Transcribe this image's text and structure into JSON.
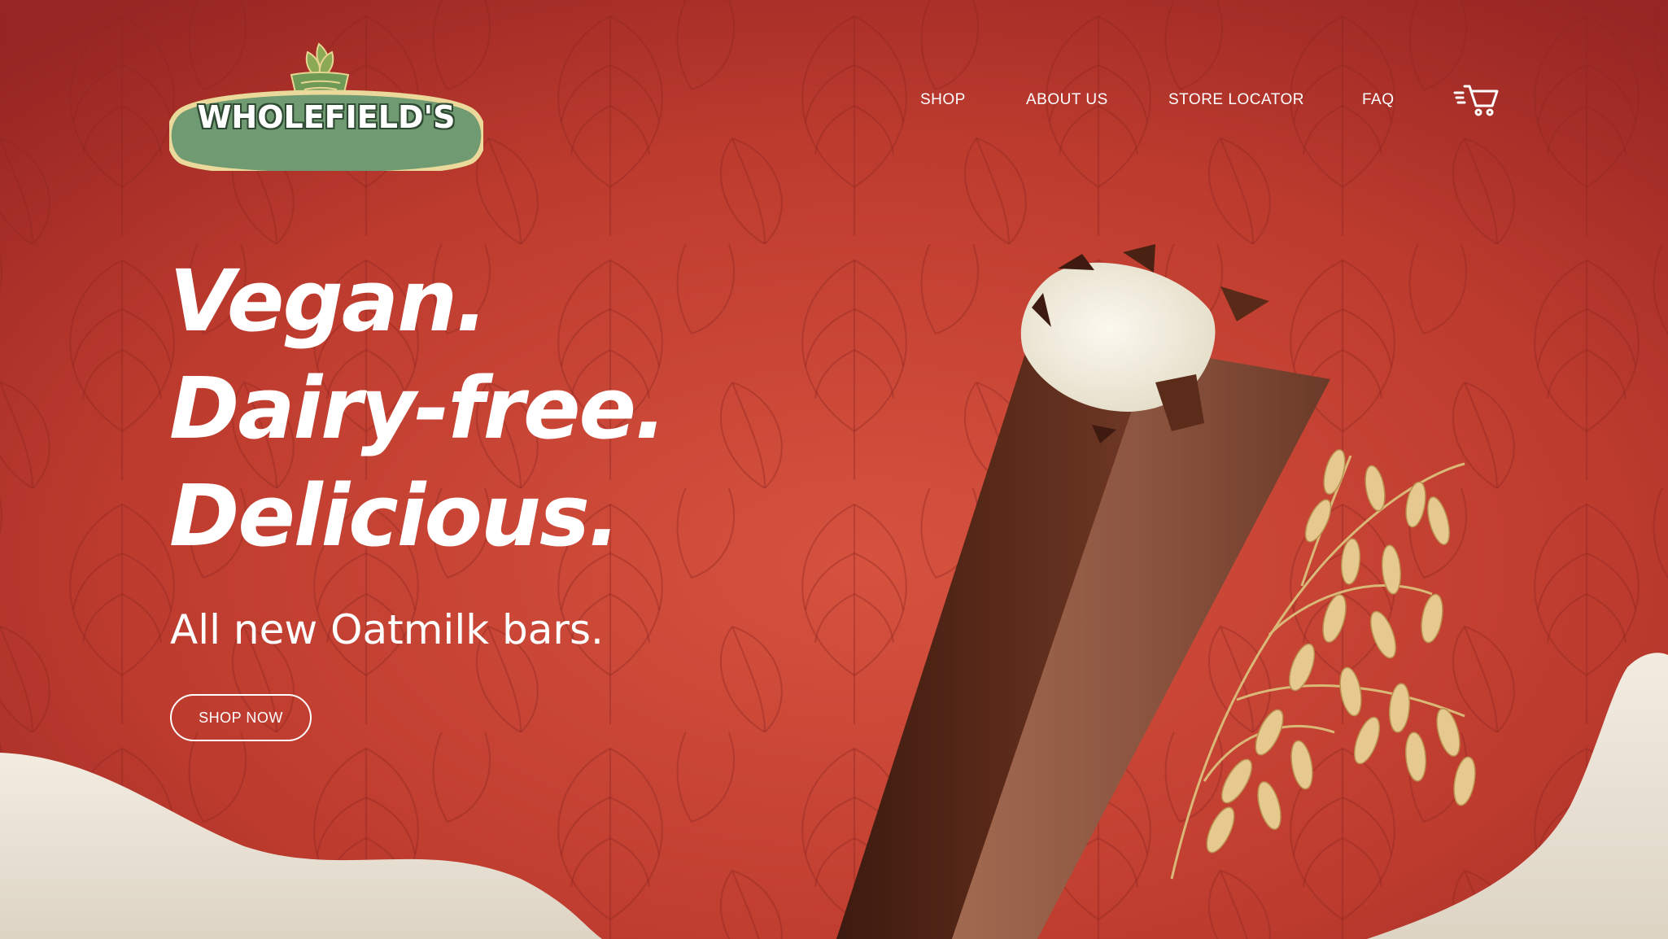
{
  "brand": {
    "logo_text": "WHOLEFIELD'S"
  },
  "nav": {
    "items": [
      {
        "label": "SHOP"
      },
      {
        "label": "ABOUT US"
      },
      {
        "label": "STORE LOCATOR"
      },
      {
        "label": "FAQ"
      }
    ],
    "cart_icon": "shopping-cart-icon"
  },
  "hero": {
    "headline": [
      "Vegan.",
      "Dairy-free.",
      "Delicious."
    ],
    "subheadline": "All new Oatmilk bars.",
    "cta_label": "SHOP NOW"
  },
  "colors": {
    "background": "#b9392c",
    "background_light": "#d5513e",
    "milk_wave": "#ece5d8",
    "chocolate": "#6b3524",
    "logo_green": "#6f9a72",
    "logo_border": "#e7d79a",
    "oat": "#e2c48a",
    "text": "#ffffff"
  }
}
